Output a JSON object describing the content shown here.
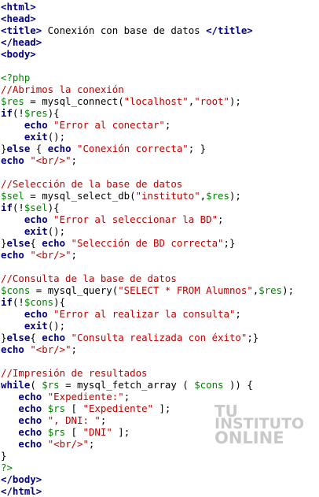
{
  "colors": {
    "tag": "#000080",
    "php_delimiter": "#008000",
    "comment": "#c00000",
    "variable": "#008000",
    "string": "#c00000",
    "keyword": "#000080",
    "watermark": "#c9c9c9"
  },
  "code_lines": [
    [
      {
        "t": "tag",
        "s": "<html>"
      }
    ],
    [
      {
        "t": "tag",
        "s": "<head>"
      }
    ],
    [
      {
        "t": "tag",
        "s": "<title>"
      },
      {
        "t": "fn",
        "s": " Conexión con base de datos "
      },
      {
        "t": "tag",
        "s": "</title>"
      }
    ],
    [
      {
        "t": "tag",
        "s": "</head>"
      }
    ],
    [
      {
        "t": "tag",
        "s": "<body>"
      }
    ],
    [],
    [
      {
        "t": "php",
        "s": "<?php"
      }
    ],
    [
      {
        "t": "cm",
        "s": "//Abrimos la conexión"
      }
    ],
    [
      {
        "t": "var",
        "s": "$res"
      },
      {
        "t": "fn",
        "s": " = mysql_connect("
      },
      {
        "t": "str",
        "s": "\"localhost\""
      },
      {
        "t": "fn",
        "s": ","
      },
      {
        "t": "str",
        "s": "\"root\""
      },
      {
        "t": "fn",
        "s": ");"
      }
    ],
    [
      {
        "t": "kw",
        "s": "if"
      },
      {
        "t": "fn",
        "s": "(!"
      },
      {
        "t": "var",
        "s": "$res"
      },
      {
        "t": "fn",
        "s": "){"
      }
    ],
    [
      {
        "t": "fn",
        "s": "    "
      },
      {
        "t": "kw",
        "s": "echo"
      },
      {
        "t": "fn",
        "s": " "
      },
      {
        "t": "str",
        "s": "\"Error al conectar\""
      },
      {
        "t": "fn",
        "s": ";"
      }
    ],
    [
      {
        "t": "fn",
        "s": "    "
      },
      {
        "t": "kw",
        "s": "exit"
      },
      {
        "t": "fn",
        "s": "();"
      }
    ],
    [
      {
        "t": "fn",
        "s": "}"
      },
      {
        "t": "kw",
        "s": "else"
      },
      {
        "t": "fn",
        "s": " { "
      },
      {
        "t": "kw",
        "s": "echo"
      },
      {
        "t": "fn",
        "s": " "
      },
      {
        "t": "str",
        "s": "\"Conexión correcta\""
      },
      {
        "t": "fn",
        "s": "; }"
      }
    ],
    [
      {
        "t": "kw",
        "s": "echo"
      },
      {
        "t": "fn",
        "s": " "
      },
      {
        "t": "str",
        "s": "\"<br/>\""
      },
      {
        "t": "fn",
        "s": ";"
      }
    ],
    [],
    [
      {
        "t": "cm",
        "s": "//Selección de la base de datos"
      }
    ],
    [
      {
        "t": "var",
        "s": "$sel"
      },
      {
        "t": "fn",
        "s": " = mysql_select_db("
      },
      {
        "t": "str",
        "s": "\"instituto\""
      },
      {
        "t": "fn",
        "s": ","
      },
      {
        "t": "var",
        "s": "$res"
      },
      {
        "t": "fn",
        "s": ");"
      }
    ],
    [
      {
        "t": "kw",
        "s": "if"
      },
      {
        "t": "fn",
        "s": "(!"
      },
      {
        "t": "var",
        "s": "$sel"
      },
      {
        "t": "fn",
        "s": "){"
      }
    ],
    [
      {
        "t": "fn",
        "s": "    "
      },
      {
        "t": "kw",
        "s": "echo"
      },
      {
        "t": "fn",
        "s": " "
      },
      {
        "t": "str",
        "s": "\"Error al seleccionar la BD\""
      },
      {
        "t": "fn",
        "s": ";"
      }
    ],
    [
      {
        "t": "fn",
        "s": "    "
      },
      {
        "t": "kw",
        "s": "exit"
      },
      {
        "t": "fn",
        "s": "();"
      }
    ],
    [
      {
        "t": "fn",
        "s": "}"
      },
      {
        "t": "kw",
        "s": "else"
      },
      {
        "t": "fn",
        "s": "{ "
      },
      {
        "t": "kw",
        "s": "echo"
      },
      {
        "t": "fn",
        "s": " "
      },
      {
        "t": "str",
        "s": "\"Selección de BD correcta\""
      },
      {
        "t": "fn",
        "s": ";}"
      }
    ],
    [
      {
        "t": "kw",
        "s": "echo"
      },
      {
        "t": "fn",
        "s": " "
      },
      {
        "t": "str",
        "s": "\"<br/>\""
      },
      {
        "t": "fn",
        "s": ";"
      }
    ],
    [],
    [
      {
        "t": "cm",
        "s": "//Consulta de la base de datos"
      }
    ],
    [
      {
        "t": "var",
        "s": "$cons"
      },
      {
        "t": "fn",
        "s": " = mysql_query("
      },
      {
        "t": "str",
        "s": "\"SELECT * FROM Alumnos\""
      },
      {
        "t": "fn",
        "s": ","
      },
      {
        "t": "var",
        "s": "$res"
      },
      {
        "t": "fn",
        "s": ");"
      }
    ],
    [
      {
        "t": "kw",
        "s": "if"
      },
      {
        "t": "fn",
        "s": "(!"
      },
      {
        "t": "var",
        "s": "$cons"
      },
      {
        "t": "fn",
        "s": "){"
      }
    ],
    [
      {
        "t": "fn",
        "s": "    "
      },
      {
        "t": "kw",
        "s": "echo"
      },
      {
        "t": "fn",
        "s": " "
      },
      {
        "t": "str",
        "s": "\"Error al realizar la consulta\""
      },
      {
        "t": "fn",
        "s": ";"
      }
    ],
    [
      {
        "t": "fn",
        "s": "    "
      },
      {
        "t": "kw",
        "s": "exit"
      },
      {
        "t": "fn",
        "s": "();"
      }
    ],
    [
      {
        "t": "fn",
        "s": "}"
      },
      {
        "t": "kw",
        "s": "else"
      },
      {
        "t": "fn",
        "s": "{ "
      },
      {
        "t": "kw",
        "s": "echo"
      },
      {
        "t": "fn",
        "s": " "
      },
      {
        "t": "str",
        "s": "\"Consulta realizada con éxito\""
      },
      {
        "t": "fn",
        "s": ";}"
      }
    ],
    [
      {
        "t": "kw",
        "s": "echo"
      },
      {
        "t": "fn",
        "s": " "
      },
      {
        "t": "str",
        "s": "\"<br/>\""
      },
      {
        "t": "fn",
        "s": ";"
      }
    ],
    [],
    [
      {
        "t": "cm",
        "s": "//Impresión de resultados"
      }
    ],
    [
      {
        "t": "kw",
        "s": "while"
      },
      {
        "t": "fn",
        "s": "( "
      },
      {
        "t": "var",
        "s": "$rs"
      },
      {
        "t": "fn",
        "s": " = mysql_fetch_array ( "
      },
      {
        "t": "var",
        "s": "$cons"
      },
      {
        "t": "fn",
        "s": " )) {"
      }
    ],
    [
      {
        "t": "fn",
        "s": "   "
      },
      {
        "t": "kw",
        "s": "echo"
      },
      {
        "t": "fn",
        "s": " "
      },
      {
        "t": "str",
        "s": "\"Expediente:\""
      },
      {
        "t": "fn",
        "s": ";"
      }
    ],
    [
      {
        "t": "fn",
        "s": "   "
      },
      {
        "t": "kw",
        "s": "echo"
      },
      {
        "t": "fn",
        "s": " "
      },
      {
        "t": "var",
        "s": "$rs"
      },
      {
        "t": "fn",
        "s": " [ "
      },
      {
        "t": "str",
        "s": "\"Expediente\""
      },
      {
        "t": "fn",
        "s": " ];"
      }
    ],
    [
      {
        "t": "fn",
        "s": "   "
      },
      {
        "t": "kw",
        "s": "echo"
      },
      {
        "t": "fn",
        "s": " "
      },
      {
        "t": "str",
        "s": "\", DNI: \""
      },
      {
        "t": "fn",
        "s": ";"
      }
    ],
    [
      {
        "t": "fn",
        "s": "   "
      },
      {
        "t": "kw",
        "s": "echo"
      },
      {
        "t": "fn",
        "s": " "
      },
      {
        "t": "var",
        "s": "$rs"
      },
      {
        "t": "fn",
        "s": " [ "
      },
      {
        "t": "str",
        "s": "\"DNI\""
      },
      {
        "t": "fn",
        "s": " ];"
      }
    ],
    [
      {
        "t": "fn",
        "s": "   "
      },
      {
        "t": "kw",
        "s": "echo"
      },
      {
        "t": "fn",
        "s": " "
      },
      {
        "t": "str",
        "s": "\"<br/>\""
      },
      {
        "t": "fn",
        "s": ";"
      }
    ],
    [
      {
        "t": "fn",
        "s": "}"
      }
    ],
    [
      {
        "t": "php",
        "s": "?>"
      }
    ],
    [
      {
        "t": "tag",
        "s": "</body>"
      }
    ],
    [
      {
        "t": "tag",
        "s": "</html>"
      }
    ]
  ],
  "watermark": {
    "line1": "TU",
    "line2": "INSTITUTO",
    "line3": "ONLINE"
  }
}
